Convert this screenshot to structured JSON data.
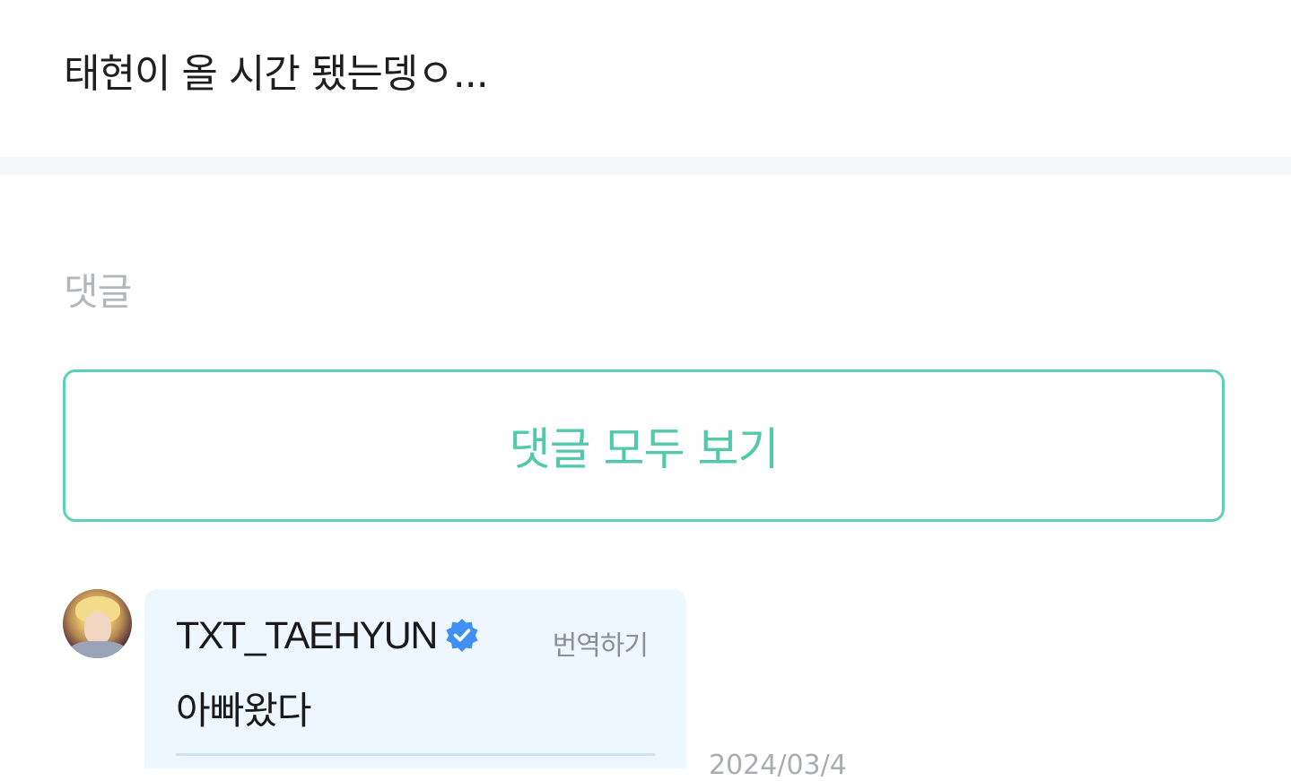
{
  "post": {
    "text": "태현이 올 시간 됐는뎅ㅇ..."
  },
  "comments": {
    "heading": "댓글",
    "view_all_label": "댓글 모두 보기",
    "items": [
      {
        "author": "TXT_TAEHYUN",
        "verified": true,
        "translate_label": "번역하기",
        "body": "아빠왔다",
        "timestamp": "2024/03/4"
      }
    ]
  },
  "colors": {
    "accent": "#52c9ab",
    "verified_badge": "#3f8ff5",
    "bubble_bg": "#eef7ff",
    "muted_text": "#b3b6bb"
  },
  "icons": {
    "verified": "verified-badge-icon"
  }
}
